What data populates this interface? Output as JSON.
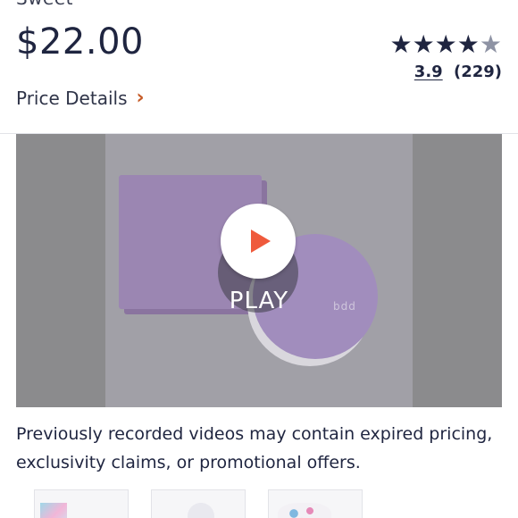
{
  "product": {
    "title_fragment": "Sweet",
    "price": "$22.00"
  },
  "rating": {
    "score": "3.9",
    "count": "(229)",
    "stars": [
      "full",
      "full",
      "full",
      "full",
      "empty"
    ]
  },
  "price_details": {
    "label": "Price Details",
    "chevron": "›"
  },
  "video": {
    "play_label": "PLAY",
    "compact_logo": "bdd"
  },
  "disclaimer": "Previously recorded videos may contain expired pricing, exclusivity claims, or promotional offers.",
  "colors": {
    "text": "#1f2540",
    "accent": "#c55a26",
    "play": "#ef5a3c",
    "lavender": "#9b86b2"
  },
  "icons": {
    "star": "star-icon",
    "chevron": "chevron-right-icon",
    "play": "play-icon"
  }
}
